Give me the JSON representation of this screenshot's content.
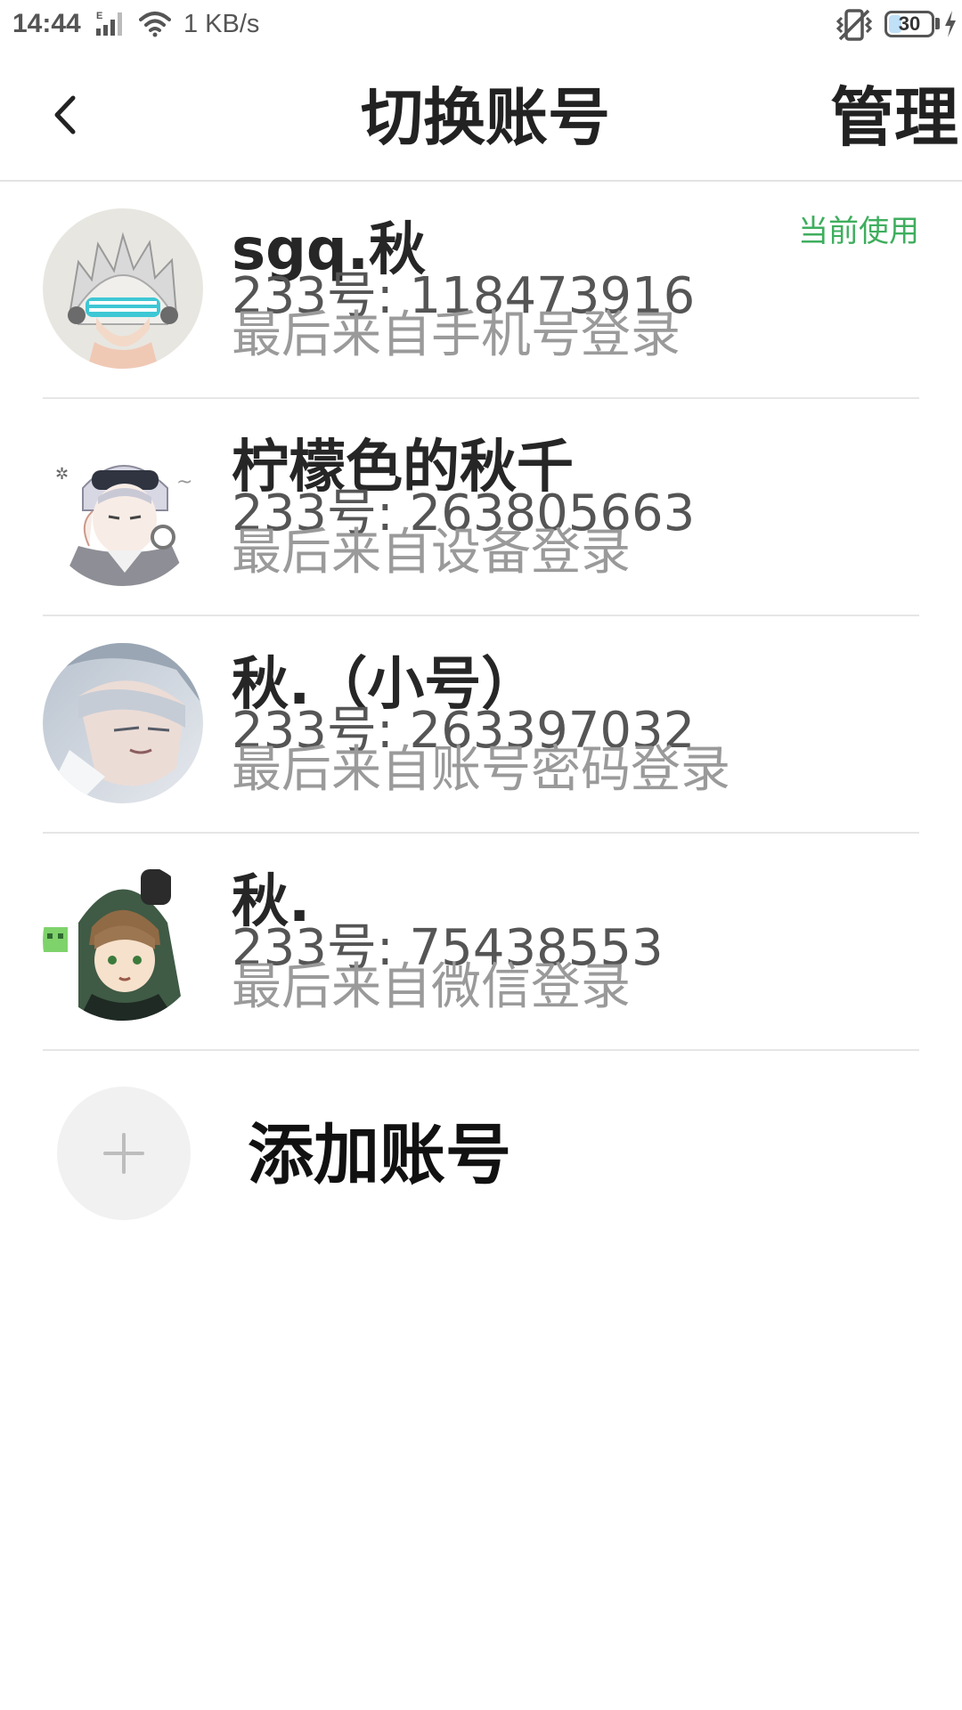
{
  "status_bar": {
    "time": "14:44",
    "network_type": "E",
    "speed": "1 KB/s",
    "battery": "30",
    "battery_level": 0.3,
    "icons": [
      "signal-icon",
      "wifi-icon",
      "vibrate-icon",
      "battery-icon",
      "charging-icon"
    ]
  },
  "header": {
    "title": "切换账号",
    "manage_label": "管理",
    "back_icon": "chevron-left-icon"
  },
  "accounts": [
    {
      "name": "sgq.秋",
      "uid": "233号: 118473916",
      "login": "最后来自手机号登录",
      "current_label": "当前使用"
    },
    {
      "name": "柠檬色的秋千",
      "uid": "233号: 263805663",
      "login": "最后来自设备登录"
    },
    {
      "name": "秋.（小号）",
      "uid": "233号: 263397032",
      "login": "最后来自账号密码登录"
    },
    {
      "name": "秋.",
      "uid": "233号: 75438553",
      "login": "最后来自微信登录"
    }
  ],
  "add_account": {
    "label": "添加账号",
    "icon": "plus-icon"
  },
  "colors": {
    "accent_green": "#3fae5e",
    "divider": "#e6e6e6",
    "secondary_text": "#555555",
    "tertiary_text": "#9a9a9a"
  }
}
